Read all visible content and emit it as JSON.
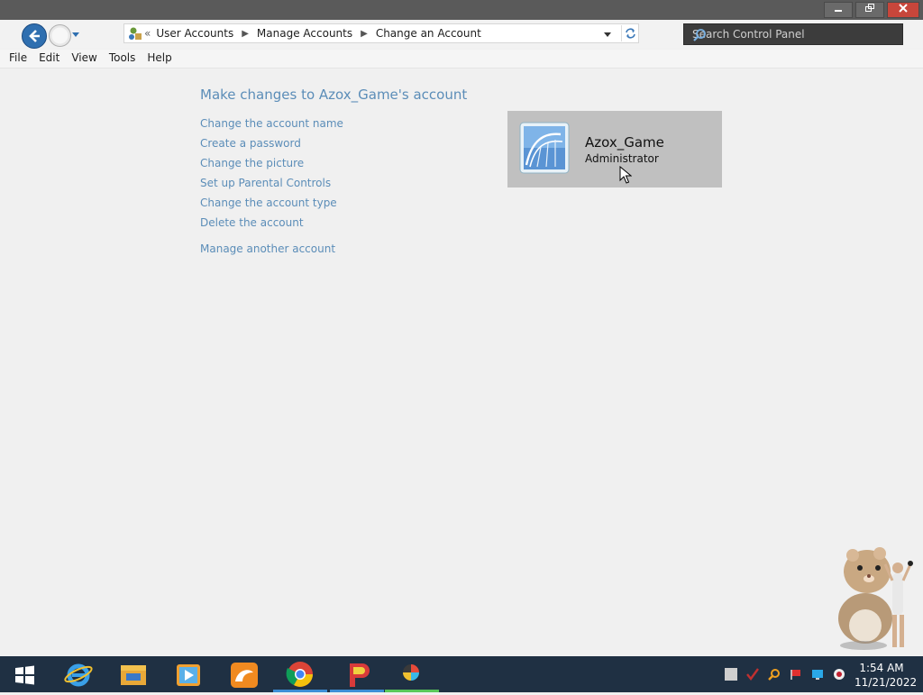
{
  "window": {
    "buttons": {
      "minimize": "minimize-icon",
      "restore": "restore-icon",
      "close": "close-icon"
    }
  },
  "nav": {
    "back": "back-arrow-icon",
    "forward": "forward-arrow-icon",
    "breadcrumb_overflow": "«",
    "breadcrumbs": [
      "User Accounts",
      "Manage Accounts",
      "Change an Account"
    ],
    "search_placeholder": "Search Control Panel"
  },
  "menu": [
    "File",
    "Edit",
    "View",
    "Tools",
    "Help"
  ],
  "main": {
    "heading": "Make changes to Azox_Game's account",
    "links": [
      "Change the account name",
      "Create a password",
      "Change the picture",
      "Set up Parental Controls",
      "Change the account type",
      "Delete the account"
    ],
    "manage_other": "Manage another account"
  },
  "account": {
    "name": "Azox_Game",
    "type": "Administrator"
  },
  "taskbar": {
    "apps": [
      "windows-start-icon",
      "internet-explorer-icon",
      "file-explorer-icon",
      "media-player-icon",
      "uc-browser-icon",
      "chrome-icon",
      "game-app-icon",
      "colorful-app-icon"
    ],
    "time": "1:54 AM",
    "date": "11/21/2022"
  },
  "colors": {
    "link": "#5b8db8",
    "taskbar": "#1f3043",
    "title_bar": "#5a5a5a",
    "close_button": "#c7463b",
    "account_tile": "#c0c0c0"
  }
}
